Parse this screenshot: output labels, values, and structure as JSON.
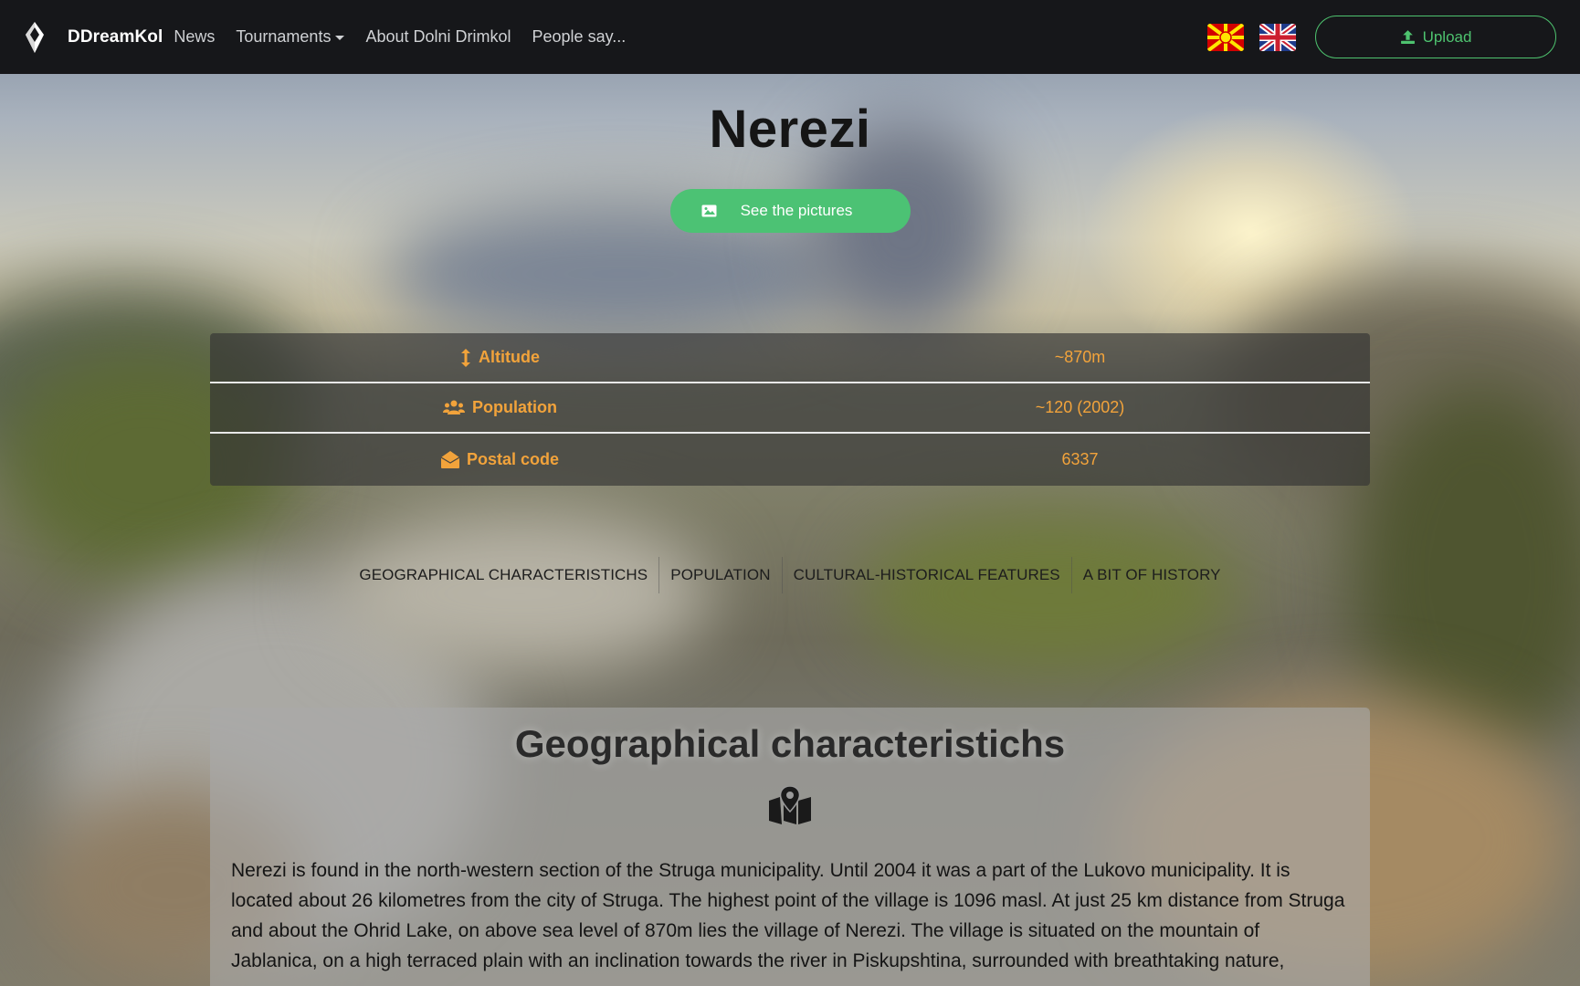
{
  "navbar": {
    "brand": "DDreamKol",
    "links": [
      {
        "label": "News",
        "dropdown": false
      },
      {
        "label": "Tournaments",
        "dropdown": true
      },
      {
        "label": "About Dolni Drimkol",
        "dropdown": false
      },
      {
        "label": "People say...",
        "dropdown": false
      }
    ],
    "languages": [
      "flag-macedonia-icon",
      "flag-uk-icon"
    ],
    "upload_label": "Upload"
  },
  "hero": {
    "title": "Nerezi",
    "pictures_button": "See the pictures"
  },
  "info": {
    "rows": [
      {
        "icon": "arrows-vertical-icon",
        "label": "Altitude",
        "value": "~870m"
      },
      {
        "icon": "users-icon",
        "label": "Population",
        "value": "~120 (2002)"
      },
      {
        "icon": "envelope-open-icon",
        "label": "Postal code",
        "value": "6337"
      }
    ]
  },
  "tabs": [
    "GEOGRAPHICAL CHARACTERISTICHS",
    "POPULATION",
    "CULTURAL-HISTORICAL FEATURES",
    "A BIT OF HISTORY"
  ],
  "section": {
    "title": "Geographical characteristichs",
    "icon": "map-marked-icon",
    "text": "Nerezi is found in the north-western section of the Struga municipality. Until 2004 it was a part of the Lukovo municipality. It is located about 26 kilometres from the city of Struga. The highest point of the village is 1096 masl. At just 25 km distance from Struga and about the Ohrid Lake, on above sea level of 870m lies the village of Nerezi. The village is situated on the mountain of Jablanica, on a high terraced plain with an inclination towards the river in Piskupshtina, surrounded with breathtaking nature,"
  },
  "colors": {
    "navbar_bg": "#16171a",
    "accent_green": "#4cc274",
    "info_text": "#f2a33b"
  }
}
